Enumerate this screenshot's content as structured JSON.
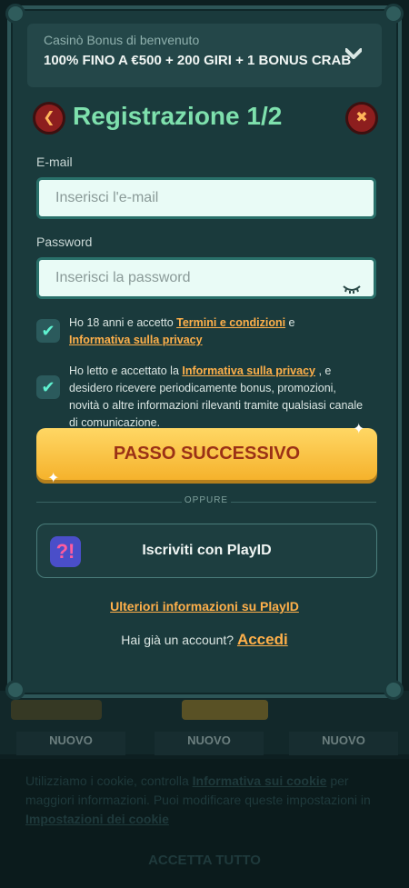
{
  "bonus": {
    "subtitle": "Casinò Bonus di benvenuto",
    "offer": "100% FINO A €500 + 200 GIRI + 1 BONUS CRAB",
    "toggle_icon": "chevron-down-icon"
  },
  "header": {
    "title": "Registrazione 1/2",
    "back_icon": "back-arrow-icon",
    "close_icon": "close-icon"
  },
  "form": {
    "email_label": "E-mail",
    "email_placeholder": "Inserisci l'e-mail",
    "password_label": "Password",
    "password_placeholder": "Inserisci la password",
    "password_toggle_icon": "eye-closed-icon"
  },
  "consents": {
    "age": {
      "checked": true,
      "text_before": "Ho 18 anni e accetto ",
      "link1": "Termini e condizioni",
      "text_mid": " e ",
      "link2": "Informativa sulla privacy"
    },
    "marketing": {
      "checked": true,
      "text_before": "Ho letto e accettato la ",
      "link": "Informativa sulla privacy",
      "text_after": " , e desidero ricevere periodicamente bonus, promozioni, novità o altre informazioni rilevanti tramite qualsiasi canale di comunicazione."
    }
  },
  "actions": {
    "next_label": "PASSO SUCCESSIVO",
    "or_label": "OPPURE",
    "playid_label": "Iscriviti con PlayID",
    "playid_more": "Ulteriori informazioni su PlayID",
    "account_question": "Hai già un account?",
    "login_link": "Accedi"
  },
  "background": {
    "badges": [
      "NUOVO",
      "NUOVO",
      "NUOVO"
    ]
  },
  "cookie_banner": {
    "text_before": "Utilizziamo i cookie, controlla ",
    "link1": "Informativa sui cookie",
    "text_mid": " per maggiori informazioni. Puoi modificare queste impostazioni in ",
    "link2": "Impostazioni dei cookie",
    "accept_label": "ACCETTA TUTTO"
  },
  "colors": {
    "accent_green": "#7ee0ad",
    "cta_yellow": "#f5b22c",
    "link_orange": "#ffb04a",
    "modal_bg": "#1a3a3c"
  }
}
